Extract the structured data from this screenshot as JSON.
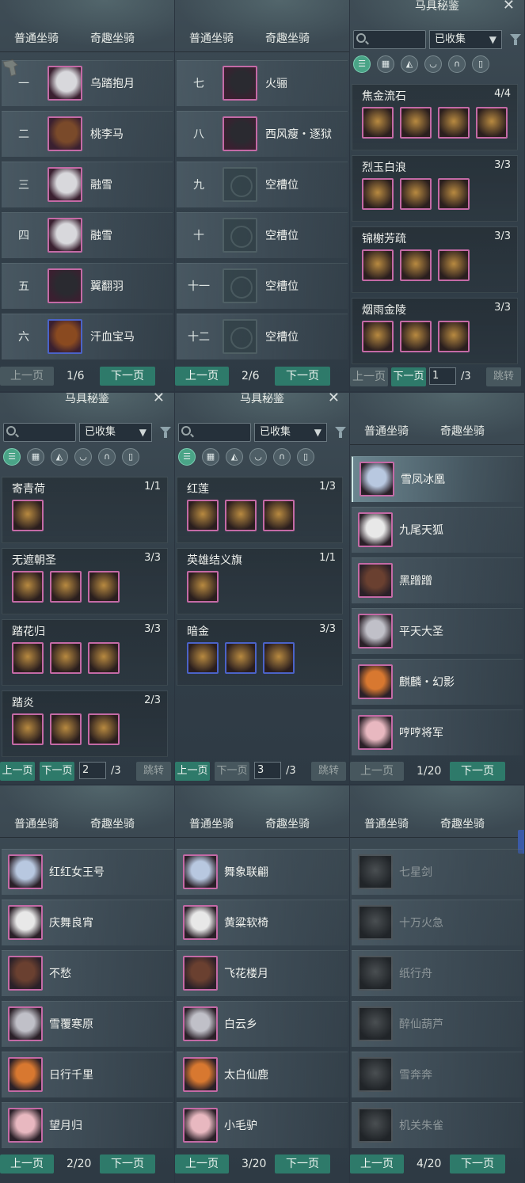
{
  "tabs": {
    "normal": "普通坐骑",
    "curio": "奇趣坐骑"
  },
  "pager": {
    "prev": "上一页",
    "next": "下一页",
    "jump": "跳转"
  },
  "gear": {
    "title": "马具秘鉴",
    "filter": "已收集",
    "search_placeholder": ""
  },
  "p1": {
    "rows": [
      {
        "num": "一",
        "name": "乌踏抱月",
        "icon": "white-horse-icon"
      },
      {
        "num": "二",
        "name": "桃李马",
        "icon": "bay-horse-icon"
      },
      {
        "num": "三",
        "name": "融雪",
        "icon": "white-horse-icon"
      },
      {
        "num": "四",
        "name": "融雪",
        "icon": "white-horse-icon"
      },
      {
        "num": "五",
        "name": "翼翻羽",
        "icon": "black-horse-icon"
      },
      {
        "num": "六",
        "name": "汗血宝马",
        "icon": "chestnut-horse-icon"
      }
    ],
    "page": "1/6"
  },
  "p2": {
    "rows": [
      {
        "num": "七",
        "name": "火骊",
        "icon": "black-horse-icon"
      },
      {
        "num": "八",
        "name": "西风瘦・逐狱",
        "icon": "black-horse-icon"
      },
      {
        "num": "九",
        "name": "空槽位",
        "icon": "empty-slot-icon"
      },
      {
        "num": "十",
        "name": "空槽位",
        "icon": "empty-slot-icon"
      },
      {
        "num": "十一",
        "name": "空槽位",
        "icon": "empty-slot-icon"
      },
      {
        "num": "十二",
        "name": "空槽位",
        "icon": "empty-slot-icon"
      }
    ],
    "page": "2/6"
  },
  "g1": {
    "sets": [
      {
        "name": "焦金流石",
        "count": "4/4",
        "items": 4
      },
      {
        "name": "烈玉白浪",
        "count": "3/3",
        "items": 3
      },
      {
        "name": "锦榭芳疏",
        "count": "3/3",
        "items": 3
      },
      {
        "name": "烟雨金陵",
        "count": "3/3",
        "items": 3
      }
    ],
    "page": "1",
    "total": "/3"
  },
  "g2": {
    "sets": [
      {
        "name": "寄青荷",
        "count": "1/1",
        "items": 1
      },
      {
        "name": "无遮朝圣",
        "count": "3/3",
        "items": 3
      },
      {
        "name": "踏花归",
        "count": "3/3",
        "items": 3
      },
      {
        "name": "踏炎",
        "count": "2/3",
        "items": 3
      }
    ],
    "page": "2",
    "total": "/3"
  },
  "g3": {
    "sets": [
      {
        "name": "红莲",
        "count": "1/3",
        "items": 3
      },
      {
        "name": "英雄结义旗",
        "count": "1/1",
        "items": 1
      },
      {
        "name": "暗金",
        "count": "3/3",
        "items": 3
      }
    ],
    "page": "3",
    "total": "/3"
  },
  "c1": {
    "rows": [
      "雪凤冰凰",
      "九尾天狐",
      "黑蹭蹭",
      "平天大圣",
      "麒麟・幻影",
      "哼哼将军"
    ],
    "page": "1/20"
  },
  "c2": {
    "rows": [
      "红红女王号",
      "庆舞良宵",
      "不愁",
      "雪覆寒原",
      "日行千里",
      "望月归"
    ],
    "page": "2/20"
  },
  "c3": {
    "rows": [
      "舞象联翩",
      "黄粱软椅",
      "飞花楼月",
      "白云乡",
      "太白仙鹿",
      "小毛驴"
    ],
    "page": "3/20"
  },
  "c4": {
    "rows": [
      "七星剑",
      "十万火急",
      "纸行舟",
      "醉仙葫芦",
      "雪奔奔",
      "机关朱雀"
    ],
    "page": "4/20"
  },
  "colors": {
    "accent": "#2e7a6a",
    "rare_border": "#c46aa6",
    "epic_border": "#4b63c8"
  }
}
